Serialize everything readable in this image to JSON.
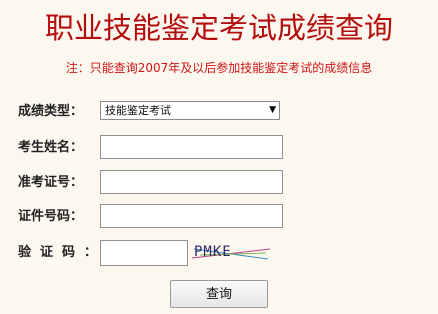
{
  "header": {
    "title": "职业技能鉴定考试成绩查询",
    "notice": "注：只能查询2007年及以后参加技能鉴定考试的成绩信息"
  },
  "form": {
    "score_type": {
      "label": "成绩类型：",
      "value": "技能鉴定考试"
    },
    "name": {
      "label": "考生姓名：",
      "value": ""
    },
    "admission_no": {
      "label": "准考证号：",
      "value": ""
    },
    "id_no": {
      "label": "证件号码：",
      "value": ""
    },
    "captcha": {
      "label": "验证码：",
      "value": "",
      "image_text": "PMKE"
    },
    "submit_label": "查询"
  },
  "colors": {
    "title": "#b50d0d",
    "notice": "#d01515",
    "background": "#fdf8ef"
  },
  "icons": {
    "select_arrow": "triangle-down-icon"
  }
}
